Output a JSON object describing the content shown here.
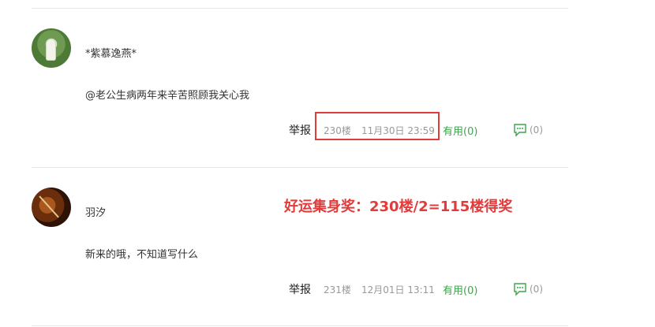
{
  "comments": [
    {
      "username": "*紫慕逸燕*",
      "text": "@老公生病两年来辛苦照顾我关心我",
      "report_label": "举报",
      "floor": "230楼",
      "datetime": "11月30日 23:59",
      "useful_label": "有用(0)",
      "reply_count": "(0)"
    },
    {
      "username": "羽汐",
      "text": "新来的哦，不知道写什么",
      "report_label": "举报",
      "floor": "231楼",
      "datetime": "12月01日 13:11",
      "useful_label": "有用(0)",
      "reply_count": "(0)"
    }
  ],
  "annotation": "好运集身奖：230楼/2=115楼得奖",
  "colors": {
    "useful": "#3aa64b",
    "highlight": "#e13b3b",
    "meta": "#999999"
  },
  "icons": {
    "reply": "speech-bubble-icon"
  }
}
